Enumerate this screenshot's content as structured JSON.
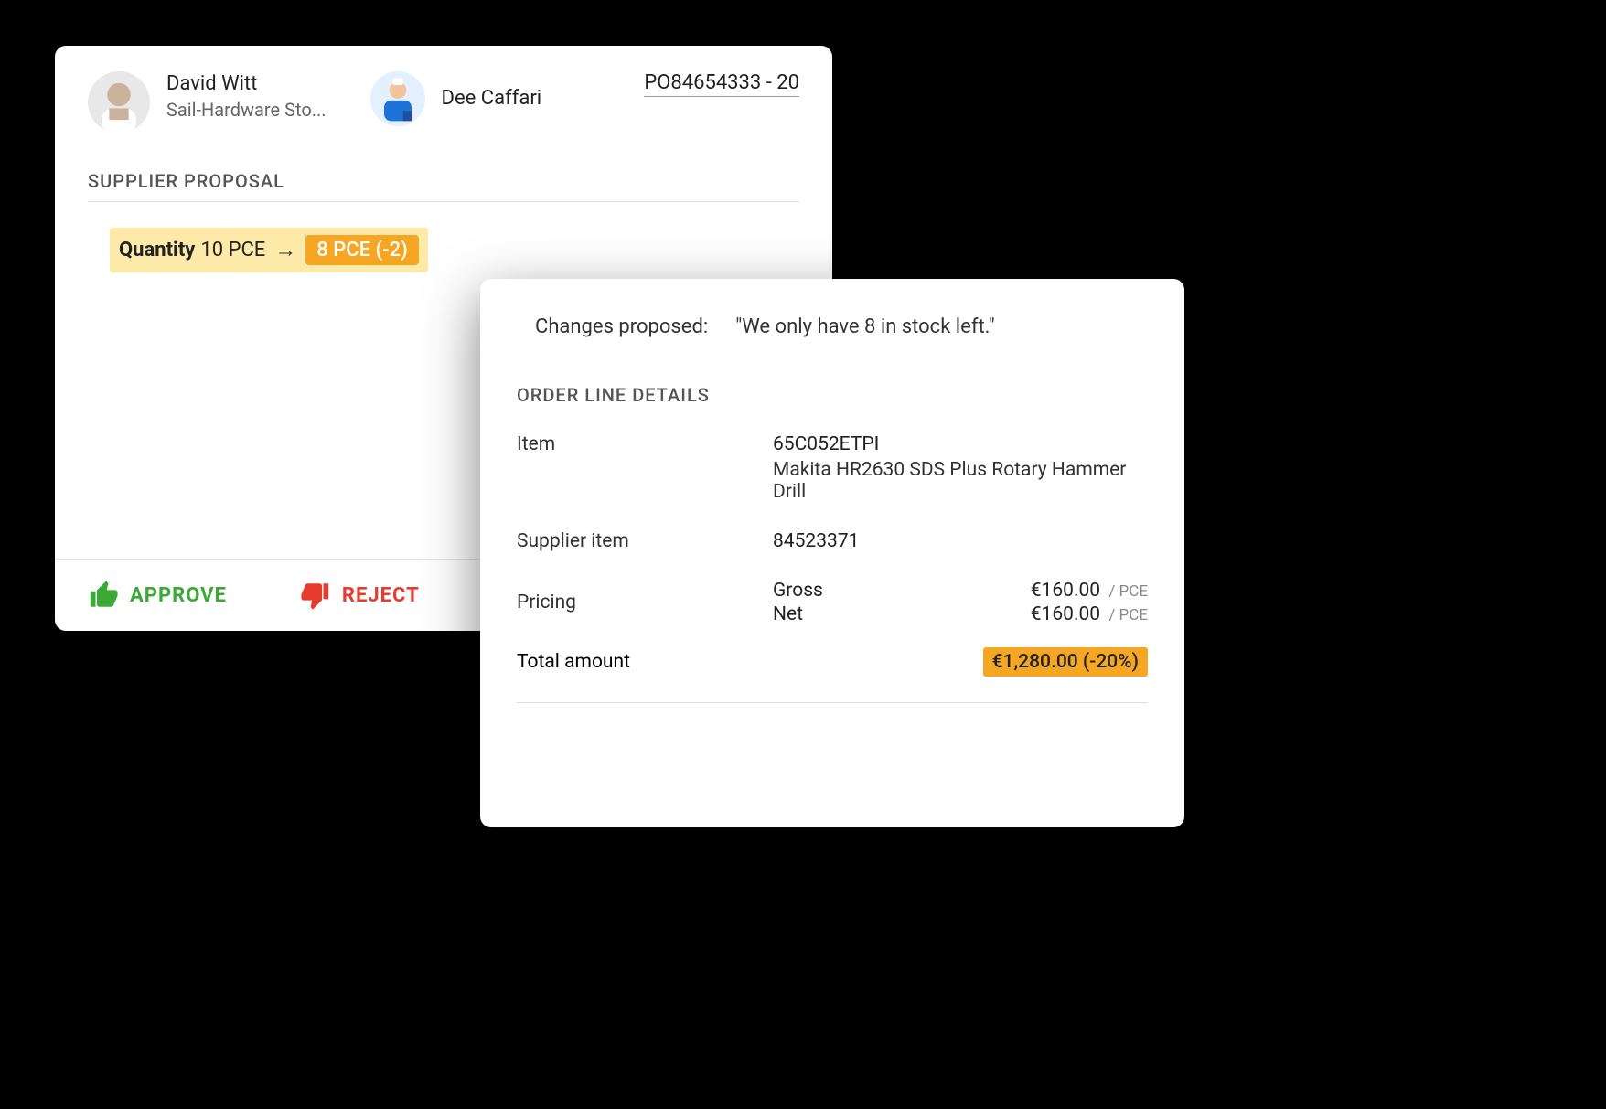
{
  "header": {
    "buyer": {
      "name": "David Witt",
      "company": "Sail-Hardware Sto..."
    },
    "supplier": {
      "name": "Dee Caffari"
    },
    "po_number": "PO84654333 - 20"
  },
  "proposal": {
    "section_title": "SUPPLIER PROPOSAL",
    "quantity": {
      "label": "Quantity",
      "old": "10 PCE",
      "arrow": "→",
      "new": "8 PCE (-2)"
    }
  },
  "actions": {
    "approve": "APPROVE",
    "reject": "REJECT"
  },
  "changes": {
    "label": "Changes proposed:",
    "text": "\"We only have 8 in stock left.\""
  },
  "order": {
    "section_title": "ORDER LINE DETAILS",
    "item_label": "Item",
    "item_code": "65C052ETPI",
    "item_desc": "Makita HR2630 SDS Plus Rotary Hammer Drill",
    "supplier_item_label": "Supplier item",
    "supplier_item": "84523371",
    "pricing_label": "Pricing",
    "gross_label": "Gross",
    "gross_value": "€160.00",
    "net_label": "Net",
    "net_value": "€160.00",
    "per_unit": "/ PCE",
    "total_label": "Total amount",
    "total_value": "€1,280.00 (-20%)"
  }
}
